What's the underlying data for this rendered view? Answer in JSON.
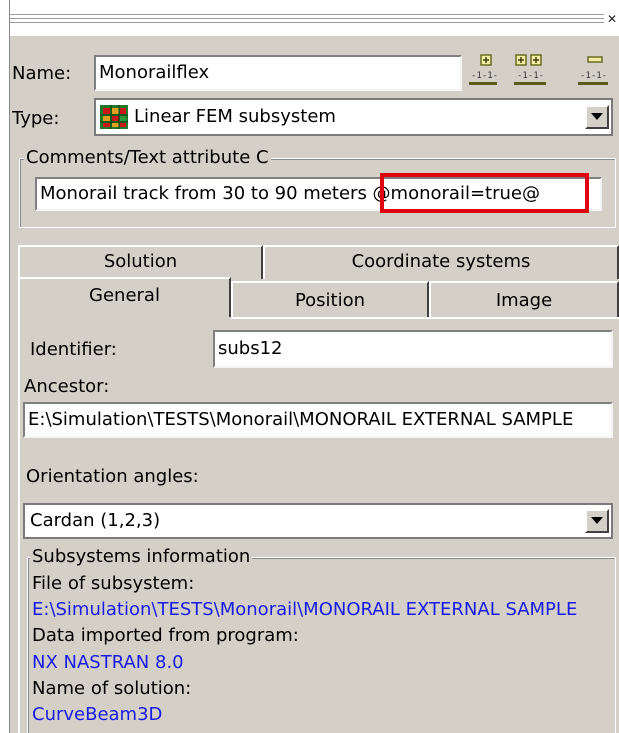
{
  "name": {
    "label": "Name:",
    "value": "Monorailflex"
  },
  "type": {
    "label": "Type:",
    "value": "Linear FEM subsystem",
    "icon": "fem-grid-icon"
  },
  "toolbar_icons": [
    "add-node-icon",
    "add-multiple-icon",
    "remove-icon"
  ],
  "comments": {
    "title": "Comments/Text attribute C",
    "value_plain": "Monorail track from 30 to 90 meters ",
    "value_attr": "@monorail=true@"
  },
  "tabs": {
    "row1": [
      "Solution",
      "Coordinate systems"
    ],
    "row2": [
      "General",
      "Position",
      "Image"
    ],
    "active": "General"
  },
  "general": {
    "identifier_label": "Identifier:",
    "identifier_value": "subs12",
    "ancestor_label": "Ancestor:",
    "ancestor_value": "E:\\Simulation\\TESTS\\Monorail\\MONORAIL EXTERNAL SAMPLE",
    "orientation_label": "Orientation angles:",
    "orientation_value": "Cardan (1,2,3)"
  },
  "subsystems_info": {
    "title": "Subsystems information",
    "file_label": "File of subsystem:",
    "file_value": "E:\\Simulation\\TESTS\\Monorail\\MONORAIL EXTERNAL SAMPLE",
    "program_label": "Data imported from program:",
    "program_value": "NX NASTRAN 8.0",
    "solution_label": "Name of solution:",
    "solution_value": "CurveBeam3D"
  },
  "colors": {
    "panel": "#d4d0c8",
    "link_blue": "#1a1ae6",
    "highlight_red": "#e0000e"
  }
}
